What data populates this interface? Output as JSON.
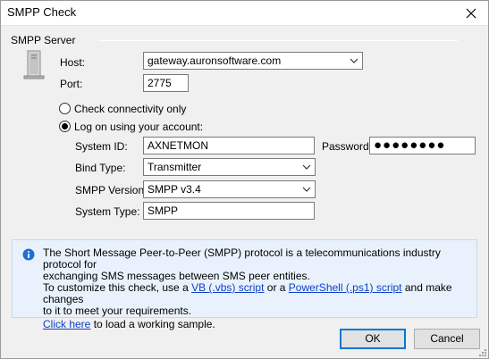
{
  "window": {
    "title": "SMPP Check"
  },
  "group": {
    "label": "SMPP Server"
  },
  "host": {
    "label": "Host:",
    "value": "gateway.auronsoftware.com"
  },
  "port": {
    "label": "Port:",
    "value": "2775"
  },
  "options": {
    "check_only": "Check connectivity only",
    "log_on": "Log on using your account:",
    "selected": "log_on"
  },
  "account": {
    "system_id_label": "System ID:",
    "system_id": "AXNETMON",
    "password_label": "Password:",
    "password_mask": "●●●●●●●●",
    "bind_type_label": "Bind Type:",
    "bind_type": "Transmitter",
    "smpp_version_label": "SMPP Version:",
    "smpp_version": "SMPP v3.4",
    "system_type_label": "System Type:",
    "system_type": "SMPP"
  },
  "info": {
    "line1": "The Short Message Peer-to-Peer (SMPP) protocol is a telecommunications industry protocol for",
    "line2": "exchanging SMS messages between SMS peer entities.",
    "line3_pre": "To customize this check, use a ",
    "vbs_link": "VB (.vbs) script",
    "line3_mid": " or a ",
    "ps_link": "PowerShell (.ps1) script",
    "line3_post": " and make changes",
    "line4": "to it to meet your requirements.",
    "click_link": "Click here",
    "line5_post": " to load a working sample."
  },
  "buttons": {
    "ok": "OK",
    "cancel": "Cancel"
  },
  "colors": {
    "link": "#0b3fcb",
    "accent": "#0078d7",
    "info_bg": "#e9f2fc"
  }
}
